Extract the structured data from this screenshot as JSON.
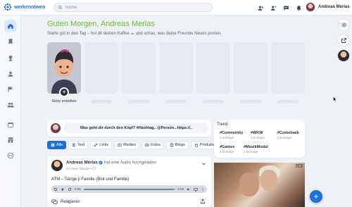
{
  "header": {
    "brand": "werkenntwen",
    "search_placeholder": "Suche",
    "user_name": "Andreas Merlas",
    "icons": [
      "people-icon",
      "friends-icon",
      "chat-icon",
      "bell-icon"
    ]
  },
  "sidebar": {
    "items": [
      {
        "name": "home-icon",
        "active": true
      },
      {
        "name": "bookmark-icon",
        "active": false
      },
      {
        "name": "trophy-icon",
        "active": false
      },
      {
        "name": "group-icon",
        "active": false
      },
      {
        "name": "flag-icon",
        "active": false
      },
      {
        "name": "people-icon",
        "active": false
      },
      {
        "name": "calendar-icon",
        "active": false
      },
      {
        "name": "store-icon",
        "active": false
      },
      {
        "name": "more-icon",
        "active": false
      }
    ]
  },
  "greeting": {
    "title": "Guten Morgen, Andreas Merlas",
    "subtitle": "Starte gut in den Tag – hol dir deinen Kaffee ☕ und schau, was deine Freunde Neues posten."
  },
  "stories": {
    "create_label": "Story erstellen",
    "placeholder_count": 6
  },
  "composer": {
    "placeholder": "Was geht dir durch den Kopf? #Hashtag.. @Person.. https://.."
  },
  "filters": [
    {
      "label": "Alle",
      "icon": "grid-icon",
      "active": true
    },
    {
      "label": "Text",
      "icon": "text-icon",
      "active": false
    },
    {
      "label": "Links",
      "icon": "link-icon",
      "active": false
    },
    {
      "label": "Medien",
      "icon": "media-icon",
      "active": false
    },
    {
      "label": "Fotos",
      "icon": "photo-icon",
      "active": false
    },
    {
      "label": "Blogs",
      "icon": "blog-icon",
      "active": false
    },
    {
      "label": "Produkte",
      "icon": "product-icon",
      "active": false
    }
  ],
  "post": {
    "author": "Andreas Merlas",
    "action": "hat eine Audio hochgeladen",
    "time": "vor einer Stunde •",
    "text": "ATM – Sänge ji Familie (Blut und Familie)",
    "audio_current": "0:00",
    "audio_duration": "2:03",
    "react_label": "Reagieren"
  },
  "trend": {
    "title": "Trend",
    "items": [
      {
        "tag": "#Community",
        "count": "4 beiträge"
      },
      {
        "tag": "#WKW",
        "count": "4 beiträge"
      },
      {
        "tag": "#Comeback",
        "count": "3 beiträge"
      },
      {
        "tag": "#Games",
        "count": "1 beiträge"
      },
      {
        "tag": "#MusikModul",
        "count": "1 beiträge"
      }
    ]
  },
  "colors": {
    "accent": "#1f6fd6",
    "greeting": "#6bbf2a",
    "background": "#eef1f6"
  }
}
